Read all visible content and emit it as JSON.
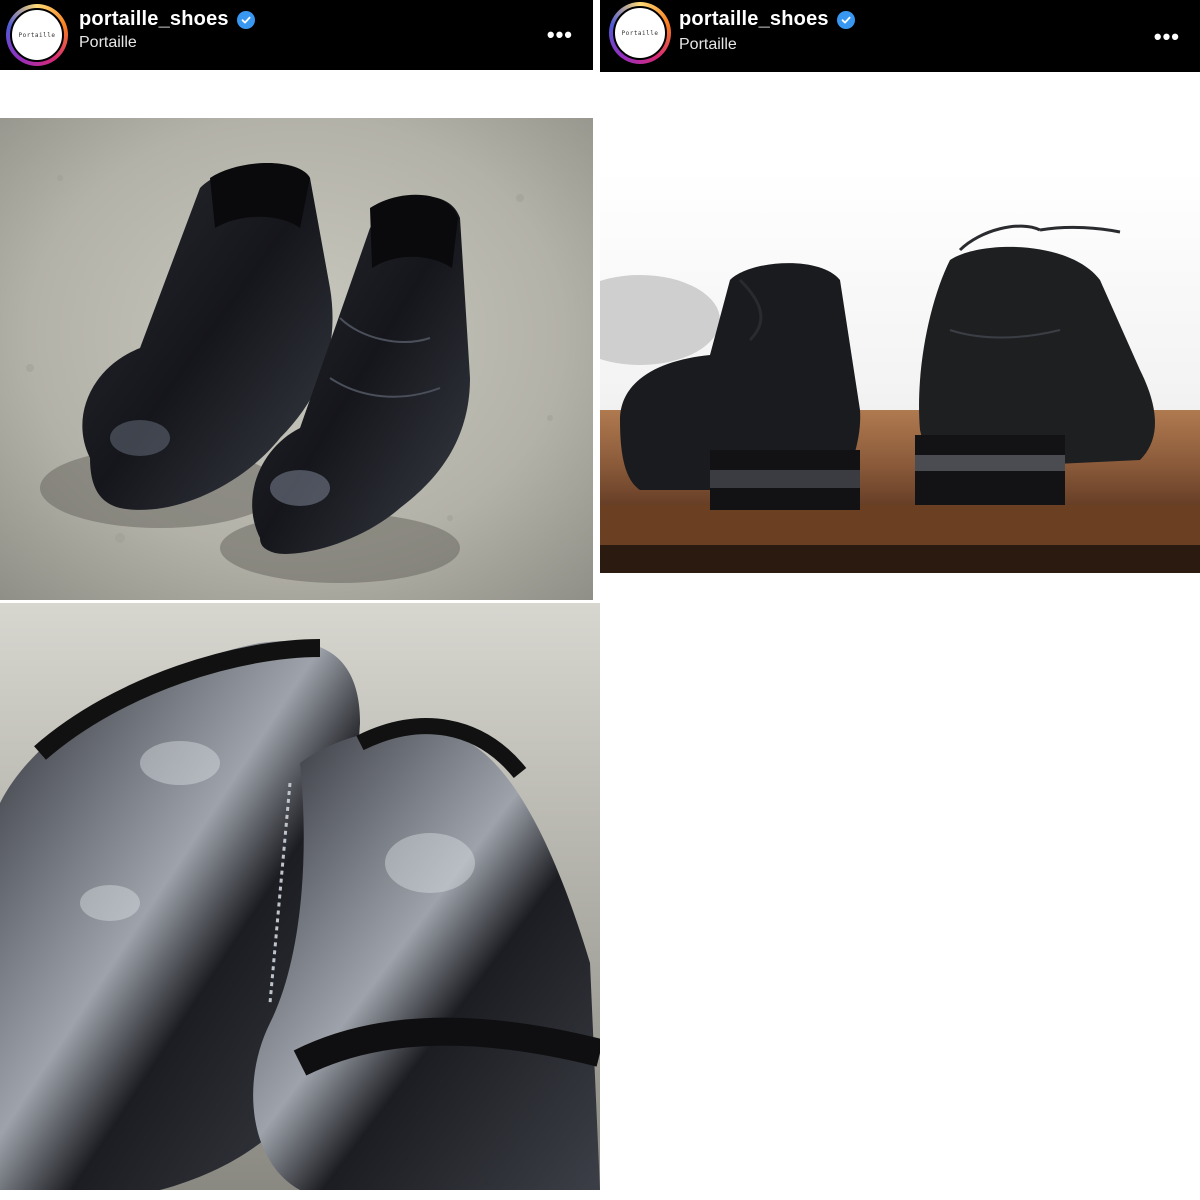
{
  "posts": [
    {
      "account": {
        "username": "portaille_shoes",
        "subtitle": "Portaille",
        "avatar_text": "Portaille",
        "verified_icon": "verified-badge-icon"
      },
      "more_icon": "more-options-icon",
      "more_label": "•••"
    },
    {
      "account": {
        "username": "portaille_shoes",
        "subtitle": "Portaille",
        "avatar_text": "Portaille",
        "verified_icon": "verified-badge-icon"
      },
      "more_icon": "more-options-icon",
      "more_label": "•••"
    }
  ],
  "colors": {
    "header_bg": "#000000",
    "verified": "#3897f0",
    "leather": "#1c1d22",
    "concrete": "#b9b8b0",
    "wood": "#8a5a3a"
  }
}
